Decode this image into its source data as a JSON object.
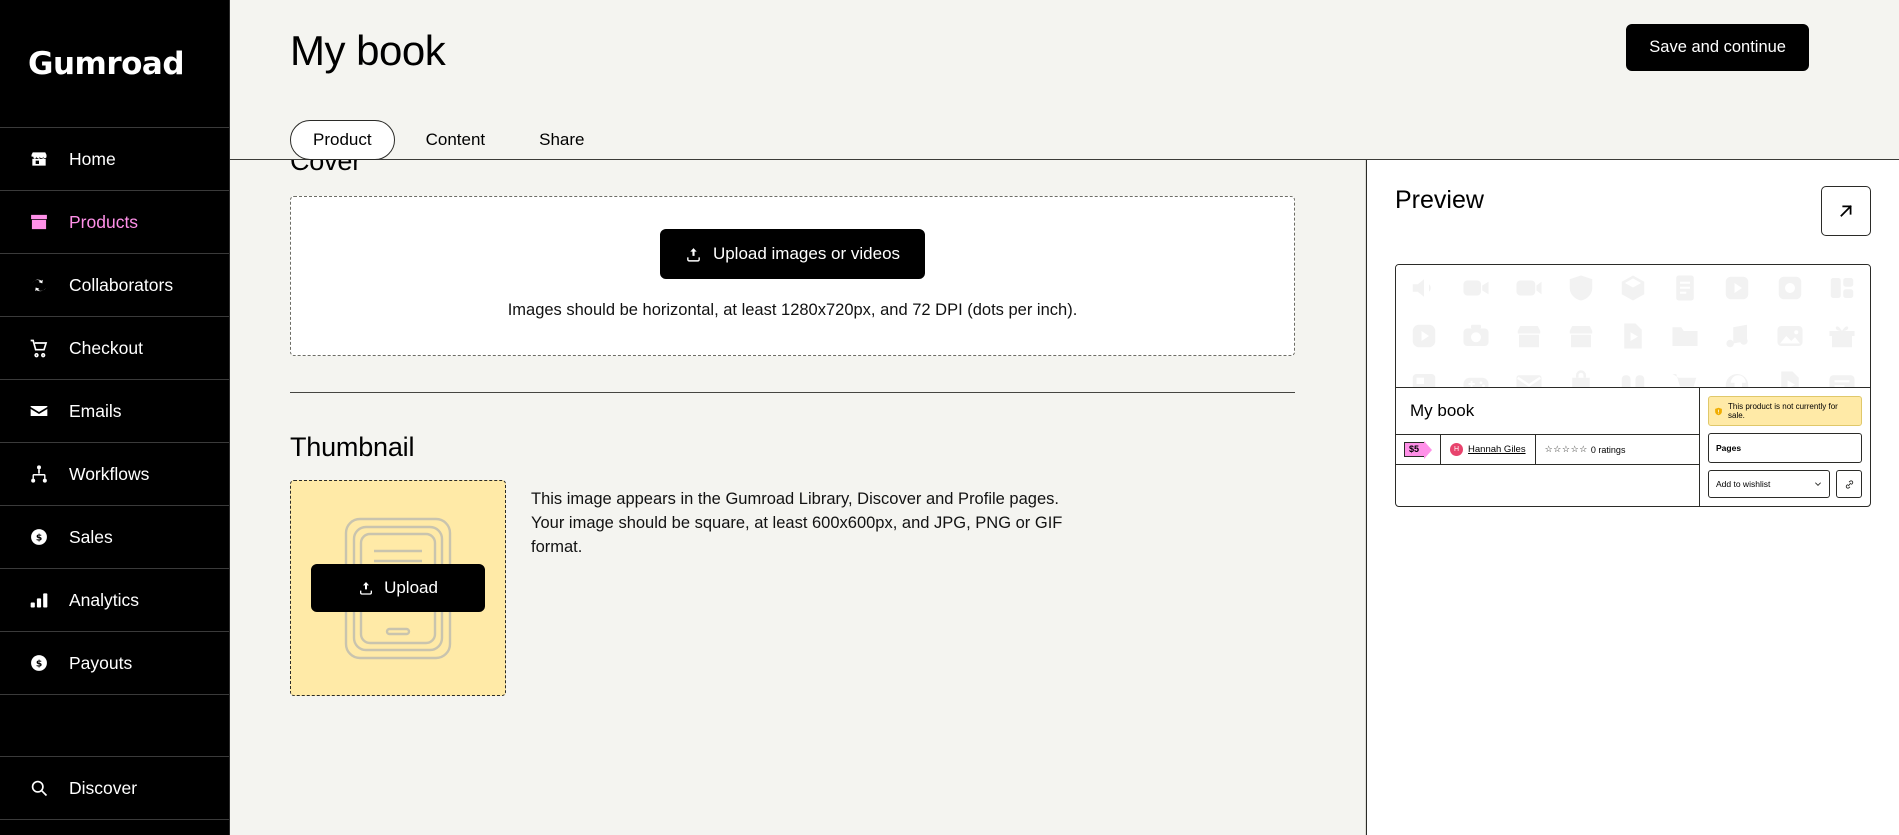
{
  "brand": {
    "name": "Gumroad"
  },
  "sidebar": {
    "items": [
      {
        "label": "Home",
        "icon": "store-icon",
        "active": false
      },
      {
        "label": "Products",
        "icon": "box-icon",
        "active": true
      },
      {
        "label": "Collaborators",
        "icon": "collaborators-icon",
        "active": false
      },
      {
        "label": "Checkout",
        "icon": "cart-icon",
        "active": false
      },
      {
        "label": "Emails",
        "icon": "envelope-icon",
        "active": false
      },
      {
        "label": "Workflows",
        "icon": "workflow-icon",
        "active": false
      },
      {
        "label": "Sales",
        "icon": "dollar-coin-icon",
        "active": false
      },
      {
        "label": "Analytics",
        "icon": "bar-chart-icon",
        "active": false
      },
      {
        "label": "Payouts",
        "icon": "dollar-coin-icon",
        "active": false
      }
    ],
    "bottom_items": [
      {
        "label": "Discover",
        "icon": "search-icon",
        "active": false
      }
    ]
  },
  "header": {
    "title": "My book",
    "save_label": "Save and continue",
    "tabs": [
      {
        "label": "Product",
        "active": true
      },
      {
        "label": "Content",
        "active": false
      },
      {
        "label": "Share",
        "active": false
      }
    ]
  },
  "cover": {
    "section_title": "Cover",
    "upload_label": "Upload images or videos",
    "hint": "Images should be horizontal, at least 1280x720px, and 72 DPI (dots per inch)."
  },
  "thumbnail": {
    "section_title": "Thumbnail",
    "upload_label": "Upload",
    "description": "This image appears in the Gumroad Library, Discover and Profile pages. Your image should be square, at least 600x600px, and JPG, PNG or GIF format."
  },
  "preview": {
    "title": "Preview",
    "expand_icon": "arrow-up-right-icon",
    "product_name": "My book",
    "price": "$5",
    "author": "Hannah Giles",
    "author_initial": "H",
    "stars": "☆☆☆☆☆",
    "ratings": "0 ratings",
    "sale_notice": "This product is not currently for sale.",
    "pages_label": "Pages",
    "wishlist_label": "Add to wishlist",
    "placeholder_icons": [
      "speaker-icon",
      "video-camera-icon",
      "video-icon",
      "shield-icon",
      "box-icon",
      "document-icon",
      "play-square-icon",
      "camera-square-icon",
      "layout-icon",
      "play-icon",
      "camera-icon",
      "store-icon",
      "store-alt-icon",
      "play-file-icon",
      "folder-icon",
      "music-icon",
      "image-icon",
      "gift-icon",
      "archive-icon",
      "gamepad-icon",
      "envelope-icon",
      "bag-icon",
      "podcast-icon",
      "cart-icon",
      "headphones-icon",
      "file-play-icon",
      "list-icon"
    ]
  },
  "colors": {
    "accent_pink": "#ff90e8",
    "background": "#f4f4f0",
    "ink": "#000000",
    "thumbnail_bg": "#ffeaa7"
  }
}
